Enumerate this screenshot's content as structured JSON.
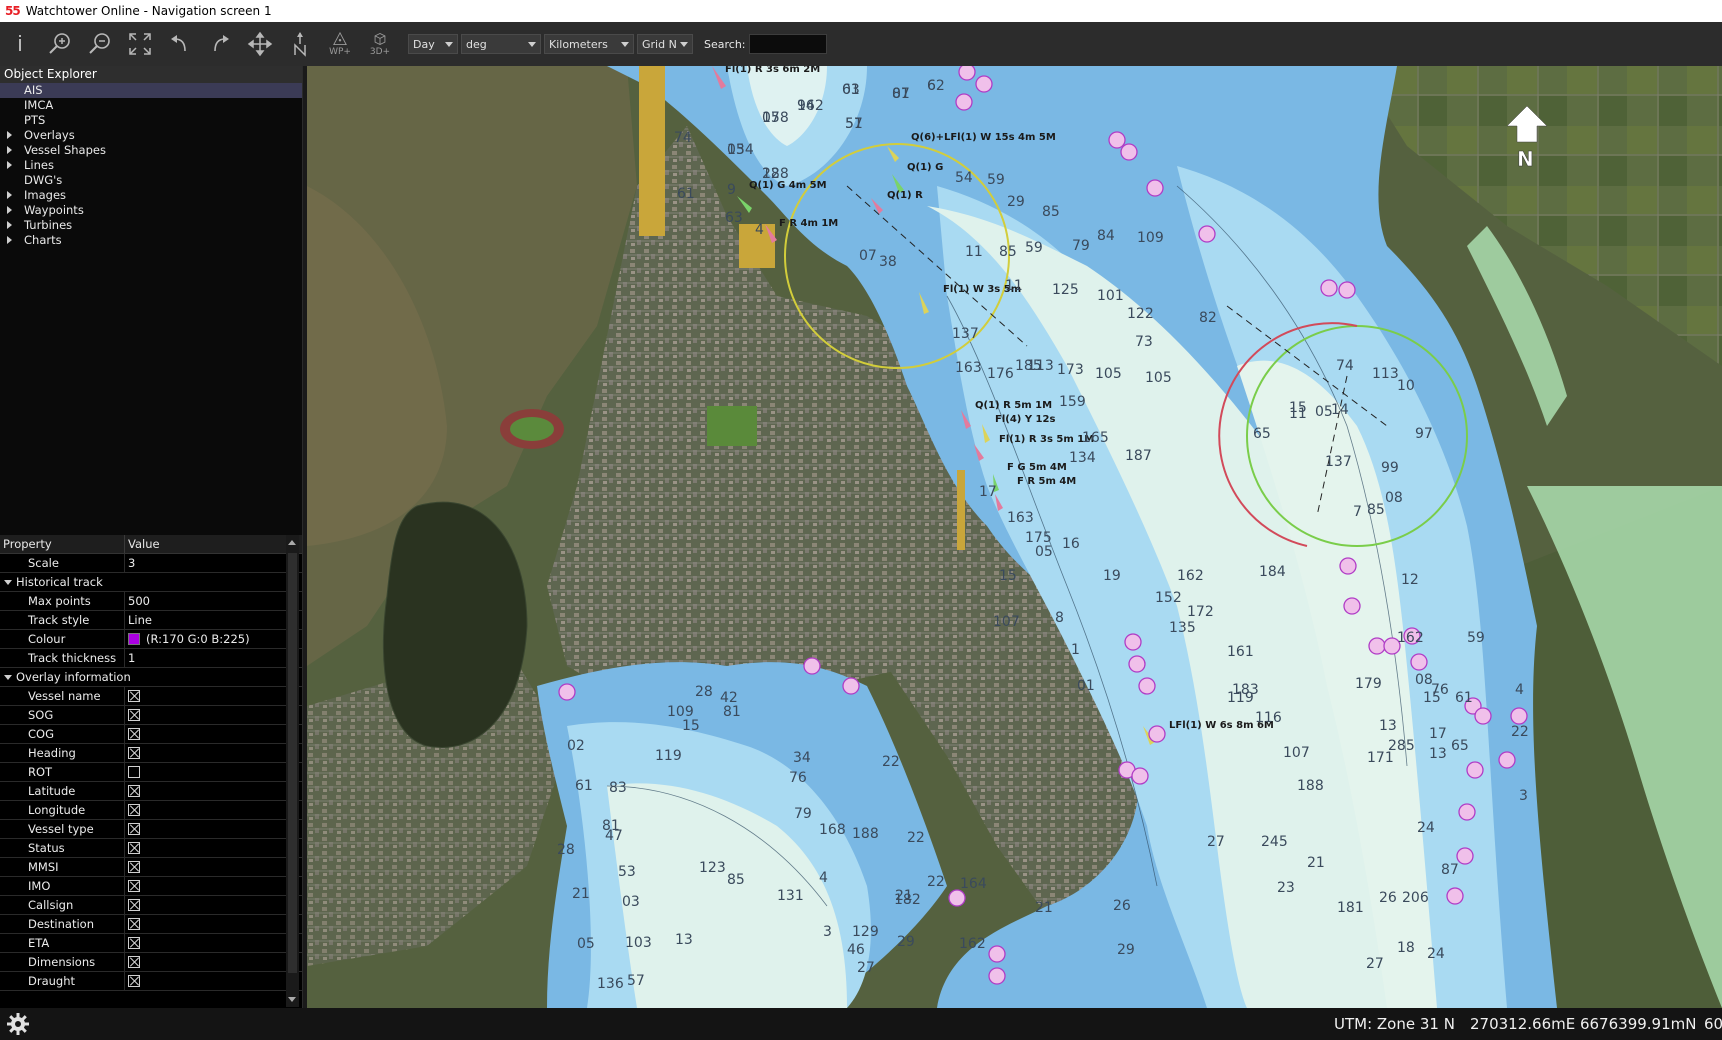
{
  "window": {
    "logo": "55",
    "title": "Watchtower Online - Navigation screen 1"
  },
  "toolbar": {
    "day_mode": "Day",
    "angle_unit": "deg",
    "distance_unit": "Kilometers",
    "north_mode": "Grid N",
    "search_label": "Search:",
    "search_value": "",
    "wp_label": "WP+",
    "d3_label": "3D+"
  },
  "object_explorer": {
    "title": "Object Explorer",
    "items": [
      {
        "label": "AIS",
        "expandable": false,
        "selected": true
      },
      {
        "label": "IMCA",
        "expandable": false
      },
      {
        "label": "PTS",
        "expandable": false
      },
      {
        "label": "Overlays",
        "expandable": true
      },
      {
        "label": "Vessel Shapes",
        "expandable": true
      },
      {
        "label": "Lines",
        "expandable": true
      },
      {
        "label": "DWG's",
        "expandable": false
      },
      {
        "label": "Images",
        "expandable": true
      },
      {
        "label": "Waypoints",
        "expandable": true
      },
      {
        "label": "Turbines",
        "expandable": true
      },
      {
        "label": "Charts",
        "expandable": true
      }
    ]
  },
  "properties": {
    "col_property": "Property",
    "col_value": "Value",
    "scale_label": "Scale",
    "scale_value": "3",
    "historical_track_label": "Historical track",
    "max_points_label": "Max points",
    "max_points_value": "500",
    "track_style_label": "Track style",
    "track_style_value": "Line",
    "colour_label": "Colour",
    "colour_value": "(R:170 G:0 B:225)",
    "colour_hex": "#aa00e1",
    "track_thickness_label": "Track thickness",
    "track_thickness_value": "1",
    "overlay_info_label": "Overlay information",
    "overlay_rows": [
      {
        "label": "Vessel name",
        "checked": true
      },
      {
        "label": "SOG",
        "checked": true
      },
      {
        "label": "COG",
        "checked": true
      },
      {
        "label": "Heading",
        "checked": true
      },
      {
        "label": "ROT",
        "checked": false
      },
      {
        "label": "Latitude",
        "checked": true
      },
      {
        "label": "Longitude",
        "checked": true
      },
      {
        "label": "Vessel type",
        "checked": true
      },
      {
        "label": "Status",
        "checked": true
      },
      {
        "label": "MMSI",
        "checked": true
      },
      {
        "label": "IMO",
        "checked": true
      },
      {
        "label": "Callsign",
        "checked": true
      },
      {
        "label": "Destination",
        "checked": true
      },
      {
        "label": "ETA",
        "checked": true
      },
      {
        "label": "Dimensions",
        "checked": true
      },
      {
        "label": "Draught",
        "checked": true
      }
    ]
  },
  "map": {
    "north_label": "N",
    "light_labels": [
      "Fl(1) R 3s 6m 2M",
      "Q(6)+LFl(1) W 15s 4m 5M",
      "Q(1) G",
      "Q(1) G 4m 5M",
      "Q(1) R",
      "F R 4m 1M",
      "Fl(1) W 3s 5m",
      "Q(1) R 5m 1M",
      "Fl(4) Y 12s",
      "Fl(1) R 3s 5m 1M",
      "F G 5m 4M",
      "F R 5m 4M",
      "LFl(1) W 6s 8m 6M"
    ],
    "soundings": [
      "61",
      "07",
      "62",
      "178",
      "162",
      "57",
      "134",
      "128",
      "74",
      "9",
      "61",
      "63",
      "4",
      "54",
      "59",
      "29",
      "85",
      "59",
      "79",
      "84",
      "109",
      "07",
      "38",
      "11",
      "85",
      "11",
      "125",
      "101",
      "122",
      "73",
      "82",
      "113",
      "173",
      "105",
      "105",
      "137",
      "163",
      "176",
      "185",
      "159",
      "165",
      "17",
      "134",
      "187",
      "163",
      "175",
      "16",
      "162",
      "152",
      "135",
      "172",
      "184",
      "161",
      "183",
      "119",
      "116",
      "107",
      "188",
      "21",
      "245",
      "27",
      "23",
      "26",
      "285",
      "24",
      "206",
      "181",
      "171",
      "179",
      "162",
      "15",
      "13",
      "13",
      "11",
      "113",
      "97",
      "10",
      "74",
      "99",
      "08",
      "137",
      "7",
      "12",
      "65",
      "15",
      "05",
      "14",
      "85",
      "76",
      "107",
      "8",
      "1",
      "01",
      "15",
      "05",
      "19",
      "22",
      "188",
      "182",
      "164",
      "162",
      "27",
      "46",
      "34",
      "76",
      "83",
      "81",
      "53",
      "119",
      "109",
      "15",
      "28",
      "42",
      "81",
      "61",
      "47",
      "21",
      "28",
      "03",
      "05",
      "136",
      "103",
      "57",
      "13",
      "123",
      "85",
      "79",
      "168",
      "131",
      "129",
      "29",
      "3",
      "4",
      "22",
      "22",
      "21",
      "21",
      "26",
      "29",
      "27",
      "18",
      "24",
      "87",
      "65",
      "59",
      "61",
      "4",
      "3",
      "17",
      "08",
      "22",
      "02",
      "03",
      "81",
      "6",
      "05",
      "94",
      "51",
      "05",
      "28"
    ]
  },
  "status": {
    "utm": "UTM: Zone 31 N",
    "coords": "270312.66mE 6676399.91mN",
    "more": "60"
  }
}
